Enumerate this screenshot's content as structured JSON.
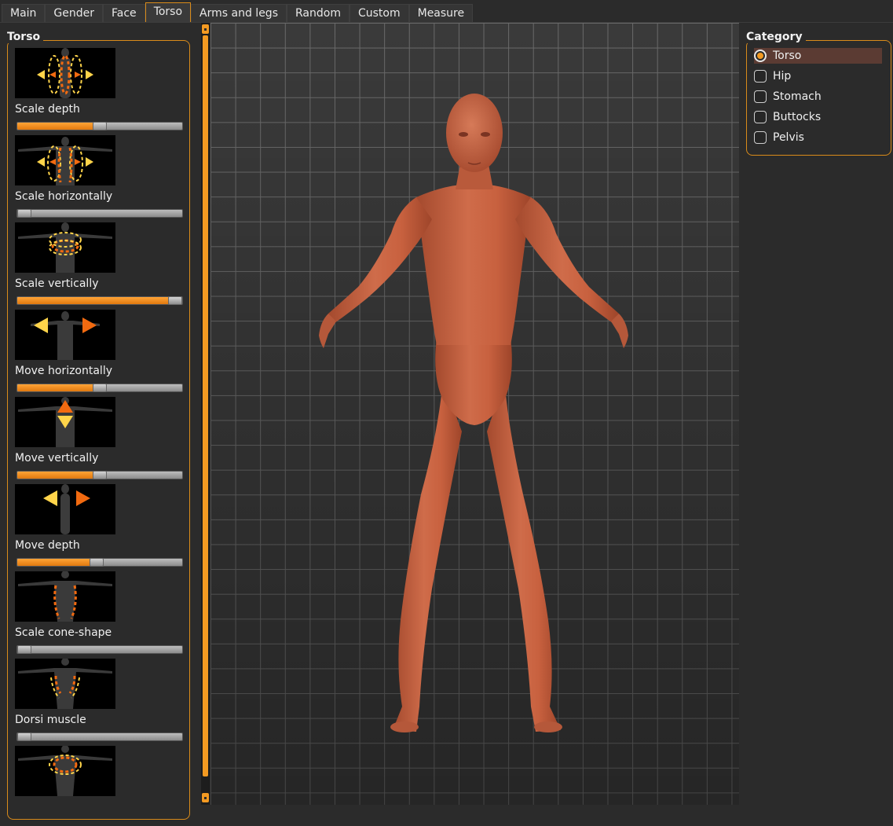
{
  "tabs": [
    {
      "label": "Main",
      "active": false
    },
    {
      "label": "Gender",
      "active": false
    },
    {
      "label": "Face",
      "active": false
    },
    {
      "label": "Torso",
      "active": true
    },
    {
      "label": "Arms and legs",
      "active": false
    },
    {
      "label": "Random",
      "active": false
    },
    {
      "label": "Custom",
      "active": false
    },
    {
      "label": "Measure",
      "active": false
    }
  ],
  "left_panel": {
    "title": "Torso",
    "sliders": [
      {
        "label": "Scale depth",
        "value": 0.5
      },
      {
        "label": "Scale horizontally",
        "value": 0.0
      },
      {
        "label": "Scale vertically",
        "value": 1.0
      },
      {
        "label": "Move horizontally",
        "value": 0.5
      },
      {
        "label": "Move vertically",
        "value": 0.5
      },
      {
        "label": "Move depth",
        "value": 0.48
      },
      {
        "label": "Scale cone-shape",
        "value": 0.0
      },
      {
        "label": "Dorsi muscle",
        "value": 0.0
      }
    ]
  },
  "right_panel": {
    "title": "Category",
    "items": [
      {
        "label": "Torso",
        "selected": true
      },
      {
        "label": "Hip",
        "selected": false
      },
      {
        "label": "Stomach",
        "selected": false
      },
      {
        "label": "Buttocks",
        "selected": false
      },
      {
        "label": "Pelvis",
        "selected": false
      }
    ]
  },
  "colors": {
    "accent": "#f39a22",
    "skin": "#c6603f",
    "selected_row": "#5b3b33"
  }
}
